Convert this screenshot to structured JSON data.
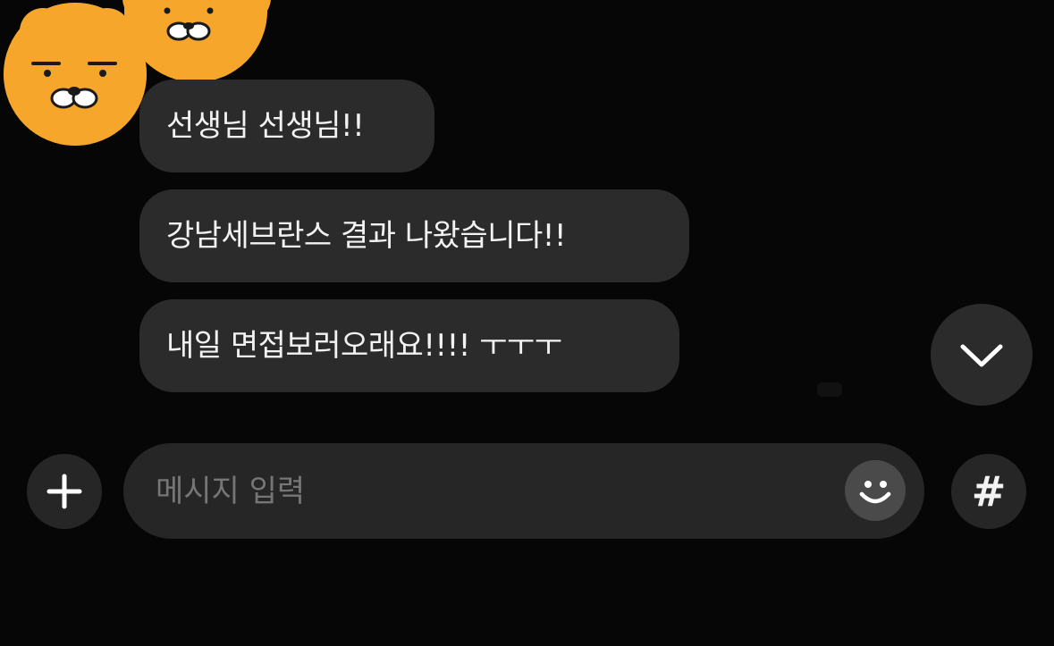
{
  "chat": {
    "messages": [
      {
        "text": "선생님 선생님!!"
      },
      {
        "text": "강남세브란스 결과 나왔습니다!!"
      },
      {
        "text": "내일 면접보러오래요!!!! ㅜㅜㅜ"
      }
    ],
    "sender_avatar_icon": "ryan-bear-avatar",
    "scroll_down_icon": "chevron-down-icon"
  },
  "input_bar": {
    "plus_icon": "plus-icon",
    "placeholder": "메시지 입력",
    "value": "",
    "emoji_icon": "emoticon-smile-icon",
    "hash_label": "#"
  },
  "colors": {
    "background": "#060606",
    "bubble": "#2b2b2b",
    "input_background": "#262626",
    "avatar": "#f6a62a",
    "text": "#f2f2f2",
    "placeholder": "#767676"
  }
}
